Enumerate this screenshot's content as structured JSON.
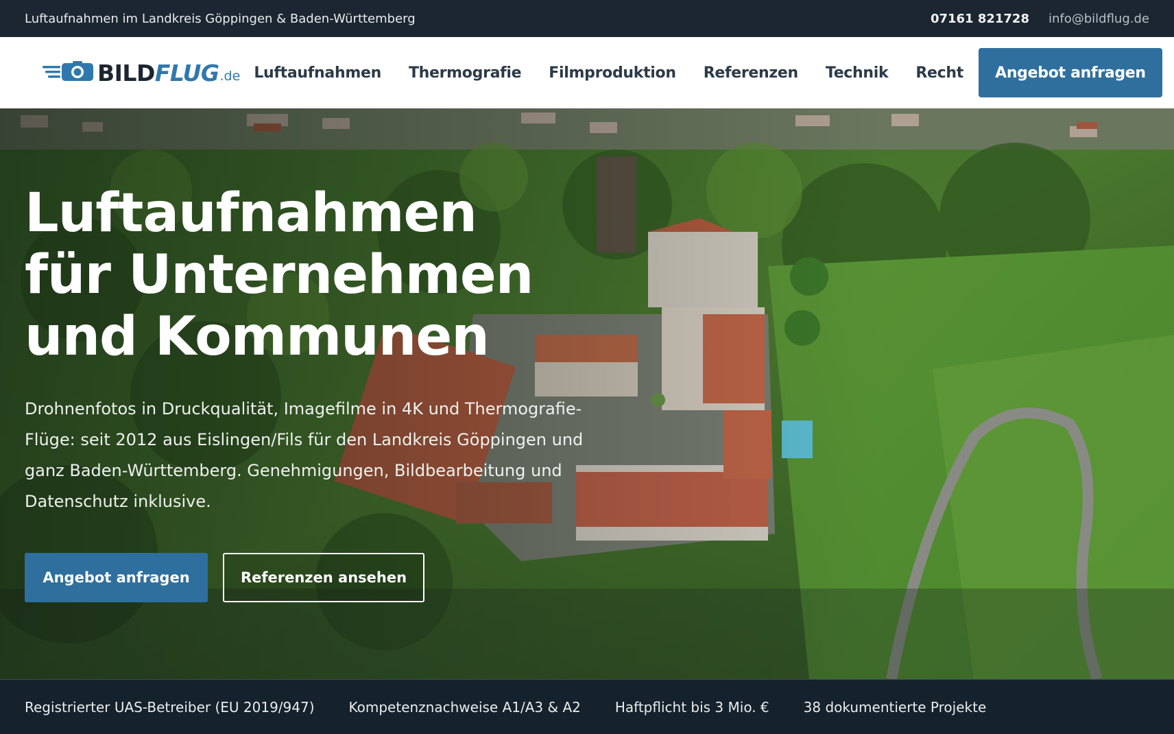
{
  "topbar": {
    "tagline": "Luftaufnahmen im Landkreis Göppingen & Baden-Württemberg",
    "phone": "07161 821728",
    "email": "info@bildflug.de"
  },
  "header": {
    "logo": {
      "part1": "BILD",
      "part2": "FLUG",
      "suffix": ".de"
    },
    "nav": [
      "Luftaufnahmen",
      "Thermografie",
      "Filmproduktion",
      "Referenzen",
      "Technik",
      "Recht"
    ],
    "cta_label": "Angebot anfragen"
  },
  "hero": {
    "title_lines": [
      "Luftaufnahmen",
      "für Unternehmen",
      "und Kommunen"
    ],
    "text": "Drohnenfotos in Druckqualität, Imagefilme in 4K und Thermografie-Flüge: seit 2012 aus Eislingen/Fils für den Landkreis Göppingen und ganz Baden-Württemberg. Genehmigungen, Bildbearbeitung und Datenschutz inklusive.",
    "primary_button": "Angebot anfragen",
    "secondary_button": "Referenzen ansehen"
  },
  "trust": [
    "Registrierter UAS-Betreiber (EU 2019/947)",
    "Kompetenznachweise A1/A3 & A2",
    "Haftpflicht bis 3 Mio. €",
    "38 dokumentierte Projekte"
  ],
  "colors": {
    "accent": "#2f6f9e",
    "topbar": "#1c2630",
    "header_bg": "#ffffff",
    "logo_blue": "#2f78ad"
  }
}
